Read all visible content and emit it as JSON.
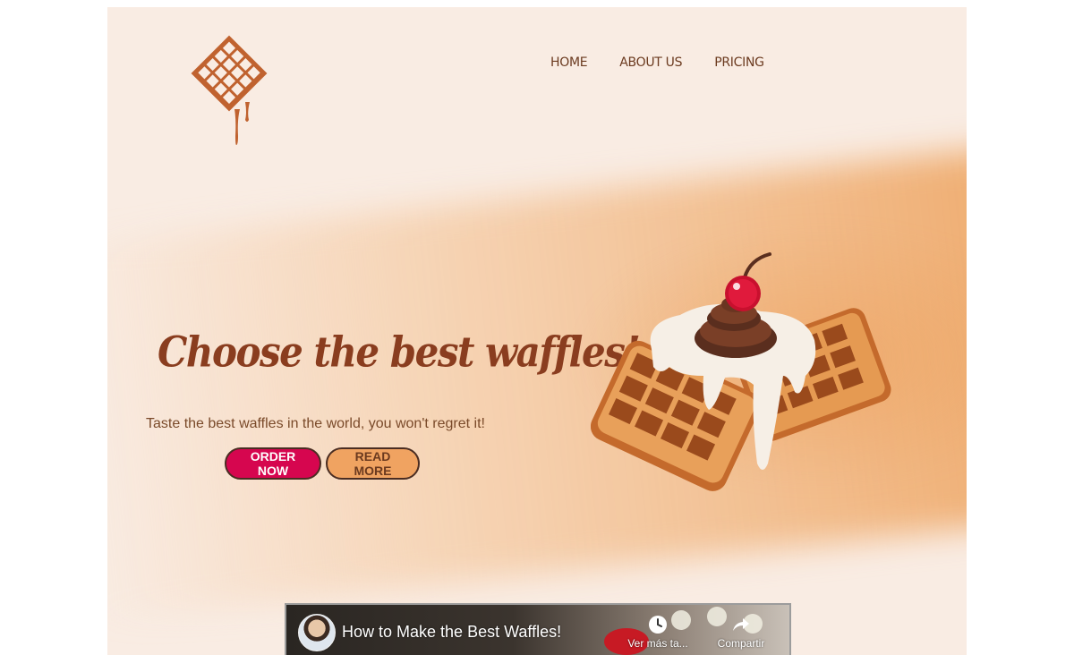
{
  "nav": {
    "items": [
      {
        "label": "HOME"
      },
      {
        "label": "ABOUT US"
      },
      {
        "label": "PRICING"
      }
    ]
  },
  "hero": {
    "title": "Choose the best waffles!",
    "subtitle": "Taste the best waffles in the world, you won't regret it!",
    "order_button": "ORDER NOW",
    "read_more_button": "READ MORE"
  },
  "video": {
    "title": "How to Make the Best Waffles!",
    "watch_later_label": "Ver más ta...",
    "share_label": "Compartir"
  },
  "colors": {
    "page_background": "#f9ece3",
    "nav_text": "#6b3a1f",
    "title_text": "#8a3d1f",
    "order_button": "#d6064f",
    "read_more_button": "#f0a361",
    "logo": "#c0622f"
  },
  "icons": {
    "logo": "waffle-logo-icon",
    "watch_later": "clock-icon",
    "share": "share-arrow-icon"
  }
}
